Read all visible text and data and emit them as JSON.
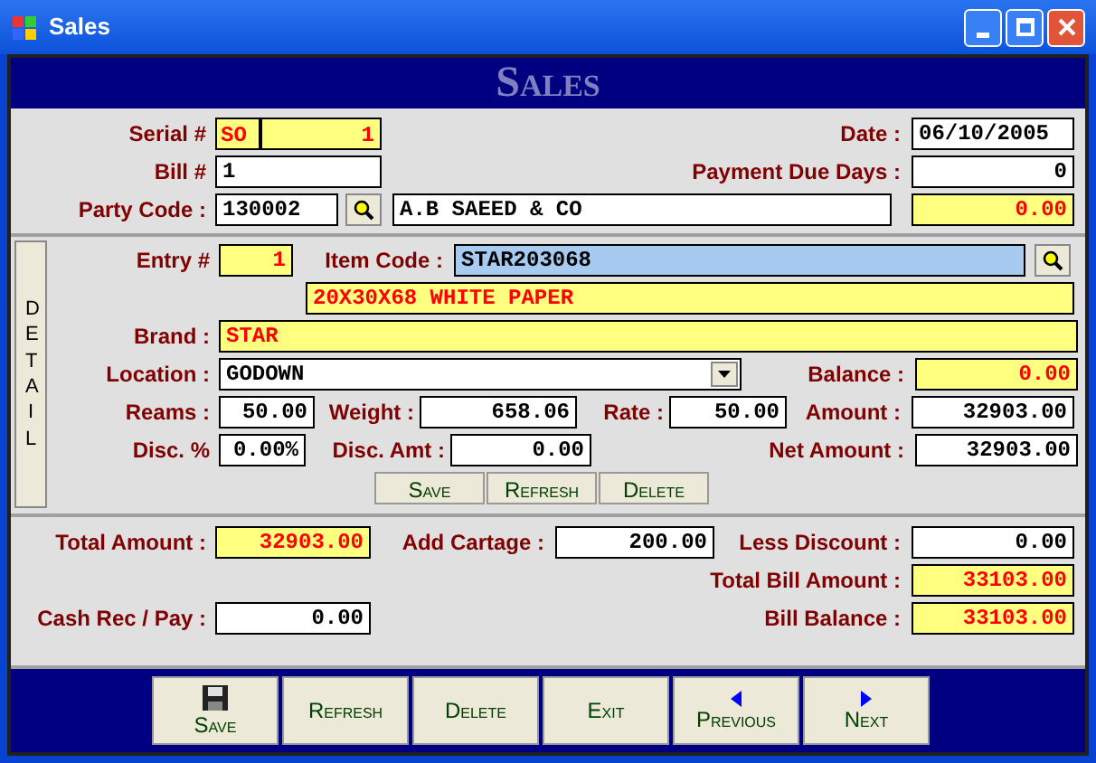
{
  "window": {
    "title": "Sales"
  },
  "banner": "Sales",
  "header": {
    "serial": {
      "label": "Serial #",
      "prefix": "SO",
      "value": "1",
      "kind": "computed"
    },
    "date": {
      "label": "Date :",
      "value": "06/10/2005",
      "kind": "entry"
    },
    "bill": {
      "label": "Bill #",
      "value": "1",
      "kind": "entry"
    },
    "payment_due_days": {
      "label": "Payment Due Days :",
      "value": "0",
      "kind": "entry"
    },
    "party_code": {
      "label": "Party Code :",
      "value": "130002",
      "kind": "entry"
    },
    "party_name": {
      "value": "A.B SAEED & CO",
      "kind": "entry"
    },
    "party_balance": {
      "value": "0.00",
      "kind": "computed"
    }
  },
  "detail": {
    "tab_label": "DETAIL",
    "entry": {
      "label": "Entry #",
      "value": "1",
      "kind": "computed"
    },
    "item_code": {
      "label": "Item Code :",
      "value": "STAR203068",
      "kind": "focused"
    },
    "item_description": {
      "value": "20X30X68 WHITE PAPER",
      "kind": "computed"
    },
    "brand": {
      "label": "Brand :",
      "value": "STAR",
      "kind": "computed"
    },
    "location": {
      "label": "Location :",
      "value": "GODOWN",
      "kind": "entry"
    },
    "balance": {
      "label": "Balance :",
      "value": "0.00",
      "kind": "computed"
    },
    "reams": {
      "label": "Reams :",
      "value": "50.00",
      "kind": "entry"
    },
    "weight": {
      "label": "Weight :",
      "value": "658.06",
      "kind": "entry"
    },
    "rate": {
      "label": "Rate :",
      "value": "50.00",
      "kind": "entry"
    },
    "amount": {
      "label": "Amount :",
      "value": "32903.00",
      "kind": "entry"
    },
    "disc_pct": {
      "label": "Disc. %",
      "value": "0.00%",
      "kind": "entry"
    },
    "disc_amt": {
      "label": "Disc. Amt :",
      "value": "0.00",
      "kind": "entry"
    },
    "net_amount": {
      "label": "Net Amount :",
      "value": "32903.00",
      "kind": "entry"
    },
    "buttons": [
      "Save",
      "Refresh",
      "Delete"
    ]
  },
  "totals": {
    "total_amount": {
      "label": "Total Amount :",
      "value": "32903.00",
      "kind": "computed"
    },
    "add_cartage": {
      "label": "Add Cartage :",
      "value": "200.00",
      "kind": "entry"
    },
    "less_discount": {
      "label": "Less Discount :",
      "value": "0.00",
      "kind": "entry"
    },
    "total_bill_amount": {
      "label": "Total Bill Amount :",
      "value": "33103.00",
      "kind": "computed"
    },
    "cash_rec_pay": {
      "label": "Cash Rec / Pay :",
      "value": "0.00",
      "kind": "entry"
    },
    "bill_balance": {
      "label": "Bill Balance :",
      "value": "33103.00",
      "kind": "computed"
    }
  },
  "toolbar": [
    {
      "label": "Save",
      "kind": "save"
    },
    {
      "label": "Refresh",
      "kind": "plain"
    },
    {
      "label": "Delete",
      "kind": "plain"
    },
    {
      "label": "Exit",
      "kind": "plain"
    },
    {
      "label": "Previous",
      "kind": "back"
    },
    {
      "label": "Next",
      "kind": "forward"
    }
  ]
}
